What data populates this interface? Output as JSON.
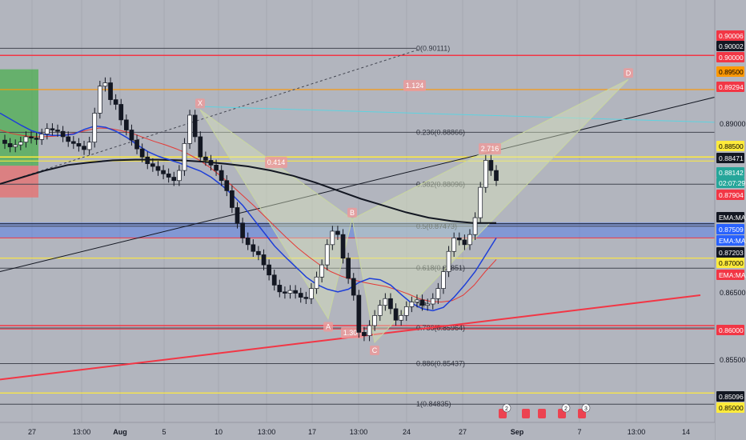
{
  "chart_data": {
    "type": "candlestick",
    "instrument_note": "",
    "price_axis": {
      "range": [
        0.846,
        0.9046
      ],
      "tick_labels": [
        "0.89000",
        "0.86500",
        "0.85500"
      ]
    },
    "time_axis": {
      "labels": [
        "27",
        "13:00",
        "Aug",
        "5",
        "10",
        "13:00",
        "17",
        "13:00",
        "24",
        "27",
        "Sep",
        "7",
        "13:00",
        "14"
      ]
    },
    "price_badges": [
      {
        "value": "0.90006",
        "bg": "#f23645",
        "fg": "#ffffff"
      },
      {
        "value": "0.90002",
        "bg": "#131722",
        "fg": "#ffffff"
      },
      {
        "value": "0.90000",
        "bg": "#f23645",
        "fg": "#ffffff"
      },
      {
        "value": "0.89500",
        "bg": "#ff9800",
        "fg": "#000000"
      },
      {
        "value": "0.89294",
        "bg": "#f23645",
        "fg": "#ffffff"
      },
      {
        "value": "0.88500",
        "bg": "#ffeb3b",
        "fg": "#000000"
      },
      {
        "value": "0.88471",
        "bg": "#131722",
        "fg": "#ffffff"
      },
      {
        "value": "0.88142",
        "bg": "#26a69a",
        "fg": "#ffffff"
      },
      {
        "value": "02:07:29",
        "bg": "#26a69a",
        "fg": "#ffffff"
      },
      {
        "value": "0.87904",
        "bg": "#f23645",
        "fg": "#ffffff"
      },
      {
        "value": "EMA:MA",
        "bg": "#131722",
        "fg": "#ffffff"
      },
      {
        "value": "0.87509",
        "bg": "#2962ff",
        "fg": "#ffffff"
      },
      {
        "value": "EMA:MA",
        "bg": "#2962ff",
        "fg": "#ffffff"
      },
      {
        "value": "0.87203",
        "bg": "#131722",
        "fg": "#ffffff"
      },
      {
        "value": "0.87000",
        "bg": "#ffeb3b",
        "fg": "#000000"
      },
      {
        "value": "EMA:MA",
        "bg": "#f23645",
        "fg": "#ffffff"
      },
      {
        "value": "0.86000",
        "bg": "#f23645",
        "fg": "#ffffff"
      },
      {
        "value": "0.85096",
        "bg": "#131722",
        "fg": "#ffffff"
      },
      {
        "value": "0.85000",
        "bg": "#ffeb3b",
        "fg": "#000000"
      }
    ],
    "horizontal_levels": [
      {
        "price": 0.90006,
        "color": "#f23645",
        "width": 1.5
      },
      {
        "price": 0.895,
        "color": "#ff9800",
        "width": 1.2
      },
      {
        "price": 0.885,
        "color": "#ffeb3b",
        "width": 1.5
      },
      {
        "price": 0.8844,
        "color": "#ffeb3b",
        "width": 1.0
      },
      {
        "price": 0.87509,
        "color": "#131722",
        "width": 1.0
      },
      {
        "price": 0.873,
        "color": "#f23645",
        "width": 1.0
      },
      {
        "price": 0.87,
        "color": "#ffeb3b",
        "width": 1.2
      },
      {
        "price": 0.86,
        "color": "#f23645",
        "width": 1.5
      },
      {
        "price": 0.8595,
        "color": "#f23645",
        "width": 1.0
      },
      {
        "price": 0.85,
        "color": "#ffeb3b",
        "width": 1.2
      }
    ],
    "fibonacci_levels": [
      {
        "label": "0(0.90111)",
        "price": 0.90111
      },
      {
        "label": "0.236(0.88866)",
        "price": 0.88866
      },
      {
        "label": "0.382(0.88096)",
        "price": 0.88096
      },
      {
        "label": "0.5(0.87473)",
        "price": 0.87473
      },
      {
        "label": "0.618(0.86851)",
        "price": 0.86851
      },
      {
        "label": "0.786(0.85964)",
        "price": 0.85964
      },
      {
        "label": "0.886(0.85437)",
        "price": 0.85437
      },
      {
        "label": "1(0.84835)",
        "price": 0.84835
      }
    ],
    "fib_partial_label": "0.7",
    "support_zone": {
      "top": 0.8753,
      "bottom": 0.873,
      "color": "#2962ff"
    },
    "pattern_points": [
      {
        "label": "X",
        "price": 0.892
      },
      {
        "label": "A",
        "price": 0.861
      },
      {
        "label": "B",
        "price": 0.8758
      },
      {
        "label": "C",
        "price": 0.8575
      },
      {
        "label": "D",
        "price": 0.8965
      }
    ],
    "pattern_ratios": [
      "1.124",
      "0.414",
      "1.307",
      "2.716"
    ],
    "trend_lines": [
      {
        "name": "upper-trend",
        "from": [
          0,
          0.868
        ],
        "to": [
          932,
          0.895
        ],
        "color": "#131722"
      },
      {
        "name": "lower-trend",
        "from": [
          0,
          0.852
        ],
        "to": [
          875,
          0.8645
        ],
        "color": "#f23645"
      },
      {
        "name": "dashed-channel",
        "from": [
          0,
          0.881
        ],
        "to": [
          525,
          0.901
        ],
        "color": "#434651"
      },
      {
        "name": "cyan-line",
        "from": [
          245,
          0.8925
        ],
        "to": [
          932,
          0.89
        ],
        "color": "#5ed3e0"
      }
    ],
    "position_box": {
      "entry": 0.8837,
      "target": 0.898,
      "stop": 0.879
    },
    "last_price": 0.88142,
    "close_series": [
      0.887,
      0.8865,
      0.8868,
      0.8872,
      0.888,
      0.8878,
      0.8876,
      0.8884,
      0.8892,
      0.889,
      0.8888,
      0.888,
      0.8873,
      0.887,
      0.8866,
      0.8861,
      0.8872,
      0.8915,
      0.8955,
      0.896,
      0.8935,
      0.8928,
      0.8905,
      0.889,
      0.8875,
      0.8862,
      0.885,
      0.884,
      0.8836,
      0.883,
      0.8825,
      0.882,
      0.8815,
      0.883,
      0.887,
      0.8912,
      0.888,
      0.885,
      0.8845,
      0.8838,
      0.883,
      0.8815,
      0.88,
      0.8775,
      0.8752,
      0.873,
      0.872,
      0.871,
      0.8705,
      0.869,
      0.8675,
      0.866,
      0.865,
      0.8648,
      0.8652,
      0.8648,
      0.8642,
      0.864,
      0.8655,
      0.8672,
      0.869,
      0.872,
      0.874,
      0.8735,
      0.87,
      0.867,
      0.8645,
      0.859,
      0.8585,
      0.86,
      0.8615,
      0.863,
      0.864,
      0.8625,
      0.8608,
      0.8615,
      0.8628,
      0.8635,
      0.8638,
      0.863,
      0.8632,
      0.864,
      0.8655,
      0.868,
      0.871,
      0.873,
      0.8727,
      0.872,
      0.8735,
      0.876,
      0.8805,
      0.8845,
      0.883,
      0.8815
    ],
    "ema_blue": [
      0.8915,
      0.8906,
      0.8897,
      0.8889,
      0.8884,
      0.8882,
      0.8882,
      0.8884,
      0.8891,
      0.8896,
      0.8894,
      0.8888,
      0.8879,
      0.8868,
      0.8858,
      0.8851,
      0.8846,
      0.8841,
      0.8835,
      0.8829,
      0.882,
      0.8808,
      0.8794,
      0.8778,
      0.8758,
      0.8738,
      0.8718,
      0.8702,
      0.8687,
      0.8672,
      0.8661,
      0.8654,
      0.865,
      0.8654,
      0.8664,
      0.867,
      0.8668,
      0.866,
      0.8646,
      0.8633,
      0.8625,
      0.8622,
      0.8627,
      0.8642,
      0.866,
      0.868,
      0.8705,
      0.873
    ],
    "ma_red": [
      0.889,
      0.8885,
      0.8882,
      0.888,
      0.888,
      0.8881,
      0.8883,
      0.8886,
      0.889,
      0.8893,
      0.8892,
      0.8889,
      0.8885,
      0.8879,
      0.8873,
      0.8868,
      0.8862,
      0.8855,
      0.8846,
      0.8835,
      0.8822,
      0.8808,
      0.8793,
      0.8778,
      0.8762,
      0.8746,
      0.873,
      0.8715,
      0.8702,
      0.869,
      0.868,
      0.8673,
      0.8668,
      0.8664,
      0.8661,
      0.8658,
      0.8653,
      0.8647,
      0.864,
      0.8636,
      0.8635,
      0.8637,
      0.8645,
      0.866,
      0.868,
      0.8698
    ],
    "ema_black": [
      0.881,
      0.882,
      0.883,
      0.8838,
      0.8842,
      0.8845,
      0.8846,
      0.8846,
      0.8845,
      0.8843,
      0.884,
      0.8836,
      0.883,
      0.8822,
      0.8812,
      0.88,
      0.8788,
      0.8778,
      0.8768,
      0.876,
      0.8755,
      0.8752,
      0.8752
    ]
  }
}
